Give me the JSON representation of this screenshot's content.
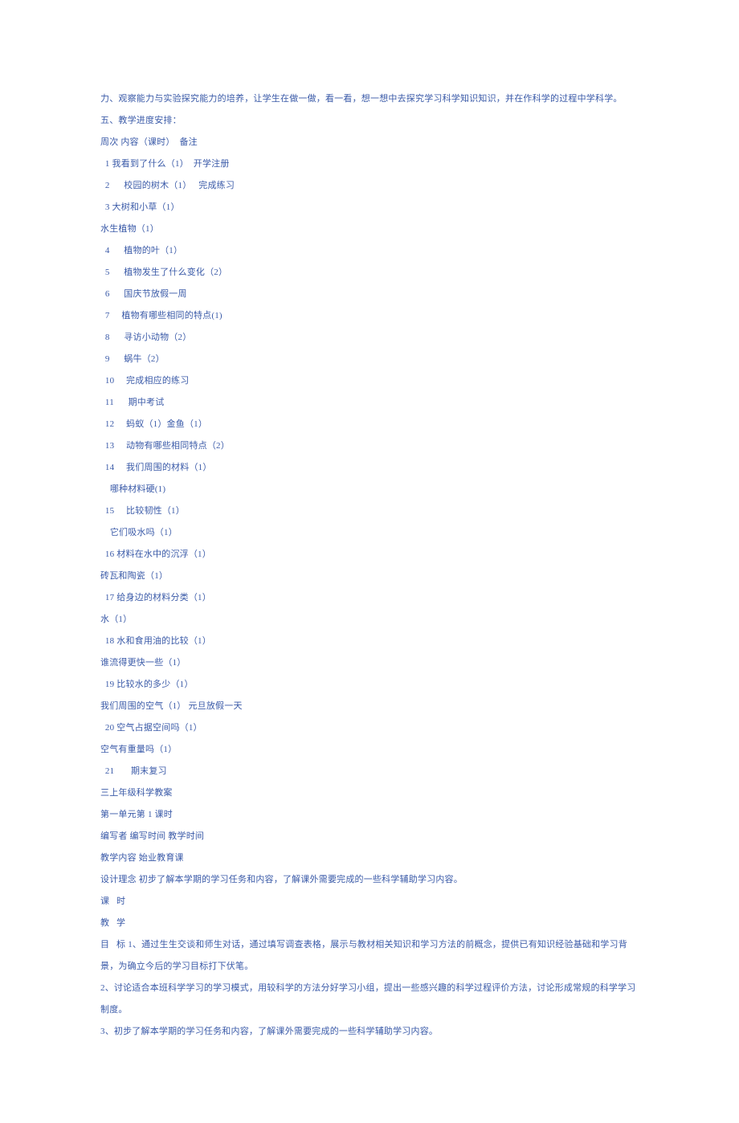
{
  "lines": [
    "力、观察能力与实验探究能力的培养，让学生在做一做，看一看，想一想中去探究学习科学知识知识，并在作科学的过程中学科学。",
    "五、教学进度安排：",
    "周次 内容（课时）  备注",
    "  1 我看到了什么（1）  开学注册",
    "  2      校园的树木（1）   完成练习",
    "  3 大树和小草（1）",
    "水生植物（1）",
    "  4      植物的叶（1）",
    "  5      植物发生了什么变化（2）",
    "  6      国庆节放假一周",
    "  7     植物有哪些相同的特点(1)",
    "  8      寻访小动物（2）",
    "  9      蜗牛（2）",
    "  10     完成相应的练习",
    "  11      期中考试",
    "  12     蚂蚁（1）金鱼（1）",
    "  13     动物有哪些相同特点（2）",
    "  14     我们周围的材料（1）",
    "    哪种材料硬(1)",
    "  15     比较韧性（1）",
    "    它们吸水吗（1）",
    "  16 材料在水中的沉浮（1）",
    "砖瓦和陶瓷（1）",
    "  17 给身边的材料分类（1）",
    "水（1）",
    "  18 水和食用油的比较（1）",
    "谁流得更快一些（1）",
    "  19 比较水的多少（1）",
    "我们周围的空气（1） 元旦放假一天",
    "  20 空气占据空间吗（1）",
    "空气有重量吗（1）",
    "  21       期末复习",
    "三上年级科学教案",
    "第一单元第 1 课时",
    "编写者 编写时间 教学时间",
    "教学内容 始业教育课",
    "设计理念 初步了解本学期的学习任务和内容，了解课外需要完成的一些科学辅助学习内容。",
    "课   时",
    "教   学",
    "目   标 1、通过生生交谈和师生对话，通过填写调查表格，展示与教材相关知识和学习方法的前概念，提供已有知识经验基础和学习背景，为确立今后的学习目标打下伏笔。",
    "2、讨论适合本班科学学习的学习模式，用较科学的方法分好学习小组，提出一些感兴趣的科学过程评价方法，讨论形成常规的科学学习制度。",
    "3、初步了解本学期的学习任务和内容，了解课外需要完成的一些科学辅助学习内容。"
  ]
}
